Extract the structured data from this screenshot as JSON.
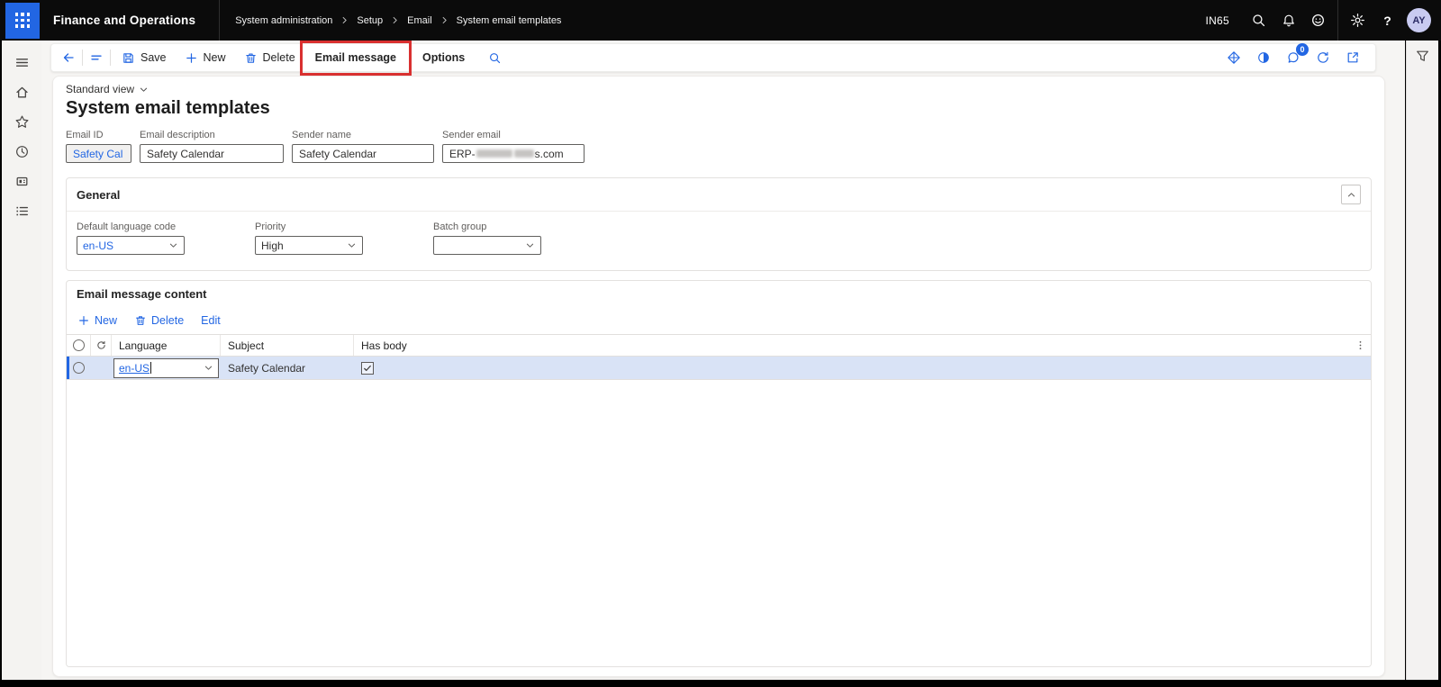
{
  "colors": {
    "accent": "#2266E3",
    "topbar_bg": "#0b0b0b",
    "selected_row": "#d9e3f6",
    "annotation_red": "#d93030",
    "page_bg": "#f6f5f3"
  },
  "icons": {
    "app_launcher": "waffle-grid",
    "search": "magnifier",
    "notifications": "bell",
    "feedback": "smiley",
    "settings": "gear",
    "help": "question-mark",
    "back": "arrow-left",
    "favorites": "star",
    "recent": "clock",
    "filter": "funnel",
    "attachments_badge": "speech-bubble-with-count"
  },
  "top_bar": {
    "app_title": "Finance and Operations",
    "breadcrumb": [
      "System administration",
      "Setup",
      "Email",
      "System email templates"
    ],
    "environment": "IN65",
    "avatar_initials": "AY"
  },
  "action_pane": {
    "save": "Save",
    "new": "New",
    "delete": "Delete",
    "email_message": "Email message",
    "options": "Options",
    "notification_badge": "0"
  },
  "page": {
    "view": "Standard view",
    "title": "System email templates"
  },
  "header_fields": {
    "email_id": {
      "label": "Email ID",
      "value": "Safety Cal"
    },
    "email_description": {
      "label": "Email description",
      "value": "Safety Calendar"
    },
    "sender_name": {
      "label": "Sender name",
      "value": "Safety Calendar"
    },
    "sender_email": {
      "label": "Sender email",
      "value_prefix": "ERP-",
      "value_suffix": "s.com",
      "redacted": true
    }
  },
  "general": {
    "title": "General",
    "default_language": {
      "label": "Default language code",
      "value": "en-US"
    },
    "priority": {
      "label": "Priority",
      "value": "High"
    },
    "batch_group": {
      "label": "Batch group",
      "value": ""
    }
  },
  "email_content": {
    "title": "Email message content",
    "toolbar": {
      "new": "New",
      "delete": "Delete",
      "edit": "Edit"
    },
    "columns": [
      "Language",
      "Subject",
      "Has body"
    ],
    "rows": [
      {
        "language": "en-US",
        "subject": "Safety Calendar",
        "has_body": true
      }
    ]
  }
}
